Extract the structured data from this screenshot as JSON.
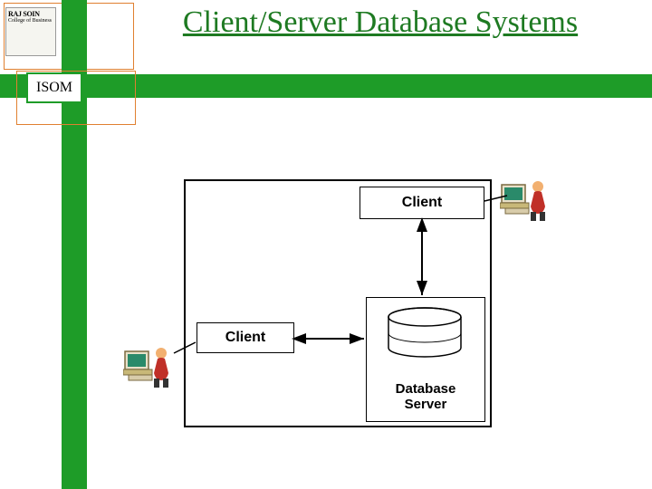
{
  "title": "Client/Server Database Systems",
  "header": {
    "isom_label": "ISOM",
    "logo_line1": "RAJ SOIN",
    "logo_line2": "College of Business"
  },
  "diagram": {
    "client_top_label": "Client",
    "client_left_label": "Client",
    "server_label_line1": "Database",
    "server_label_line2": "Server"
  },
  "colors": {
    "green": "#1e9c28",
    "title_green": "#1e7a22",
    "orange": "#e08030"
  }
}
